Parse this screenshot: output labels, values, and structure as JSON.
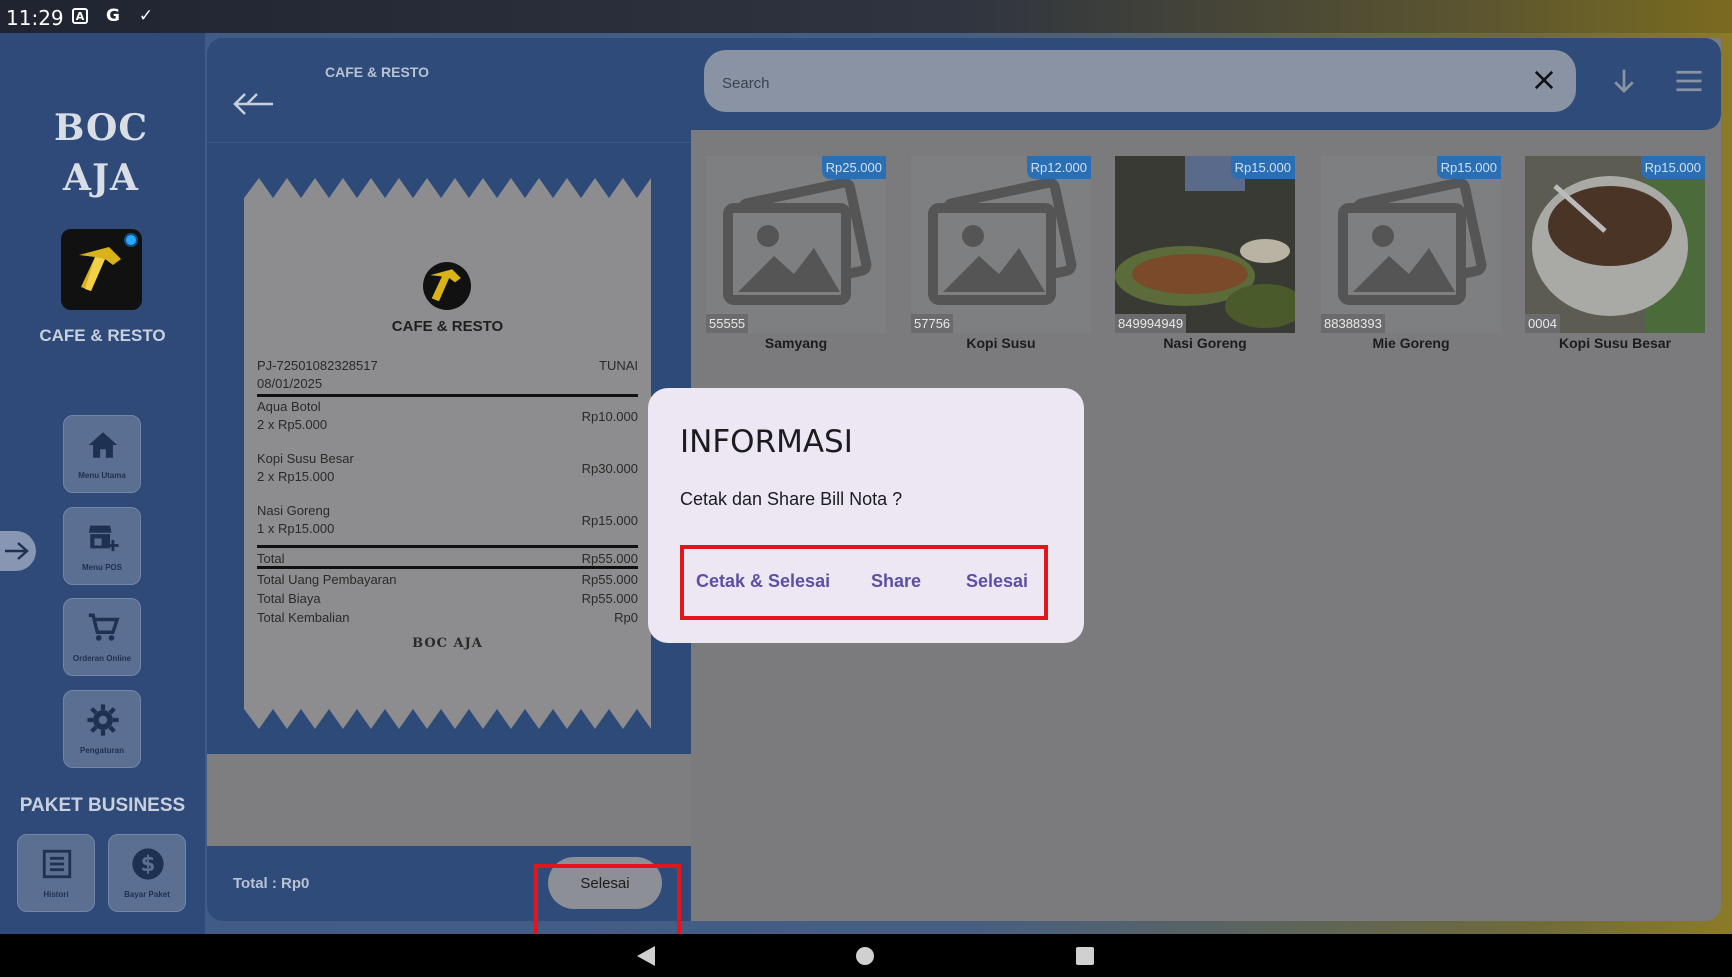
{
  "status_bar": {
    "time": "11:29",
    "icons": [
      "a-box-icon",
      "google-icon",
      "check-icon"
    ]
  },
  "sidebar": {
    "brand": "BOC AJA",
    "store_name": "CAFE & RESTO",
    "nav": [
      {
        "label": "Menu Utama",
        "icon": "home-icon"
      },
      {
        "label": "Menu POS",
        "icon": "store-add-icon"
      },
      {
        "label": "Orderan Online",
        "icon": "cart-icon"
      },
      {
        "label": "Pengaturan",
        "icon": "gear-icon"
      }
    ],
    "paket_title": "PAKET BUSINESS",
    "paket_buttons": [
      {
        "label": "Histori",
        "icon": "list-icon"
      },
      {
        "label": "Bayar Paket",
        "icon": "dollar-icon"
      }
    ]
  },
  "cart": {
    "header_title": "CAFE & RESTO",
    "receipt": {
      "store_name": "CAFE & RESTO",
      "invoice": "PJ-72501082328517",
      "payment": "TUNAI",
      "date": "08/01/2025",
      "items": [
        {
          "name": "Aqua Botol",
          "qty": "2 x Rp5.000",
          "amount": "Rp10.000"
        },
        {
          "name": "Kopi Susu Besar",
          "qty": "2 x Rp15.000",
          "amount": "Rp30.000"
        },
        {
          "name": "Nasi Goreng",
          "qty": "1 x Rp15.000",
          "amount": "Rp15.000"
        }
      ],
      "total_label": "Total",
      "total_value": "Rp55.000",
      "paid_label": "Total Uang Pembayaran",
      "paid_value": "Rp55.000",
      "cost_label": "Total Biaya",
      "cost_value": "Rp55.000",
      "change_label": "Total Kembalian",
      "change_value": "Rp0",
      "footer": "BOC AJA"
    },
    "footer_total": "Total :  Rp0",
    "finish_button": "Selesai"
  },
  "search": {
    "placeholder": "Search"
  },
  "products": [
    {
      "name": "Samyang",
      "price": "Rp25.000",
      "code": "55555",
      "photo": false
    },
    {
      "name": "Kopi Susu",
      "price": "Rp12.000",
      "code": "57756",
      "photo": false
    },
    {
      "name": "Nasi Goreng",
      "price": "Rp15.000",
      "code": "849994949",
      "photo": true
    },
    {
      "name": "Mie Goreng",
      "price": "Rp15.000",
      "code": "88388393",
      "photo": false
    },
    {
      "name": "Kopi Susu Besar",
      "price": "Rp15.000",
      "code": "0004",
      "photo": true
    }
  ],
  "dialog": {
    "title": "INFORMASI",
    "message": "Cetak dan Share Bill Nota ?",
    "actions": [
      "Cetak & Selesai",
      "Share",
      "Selesai"
    ]
  },
  "colors": {
    "accent": "#5e4fa2",
    "highlight": "#e0161c",
    "price_badge": "#2a6fb4",
    "panel": "#2f4b7a"
  }
}
